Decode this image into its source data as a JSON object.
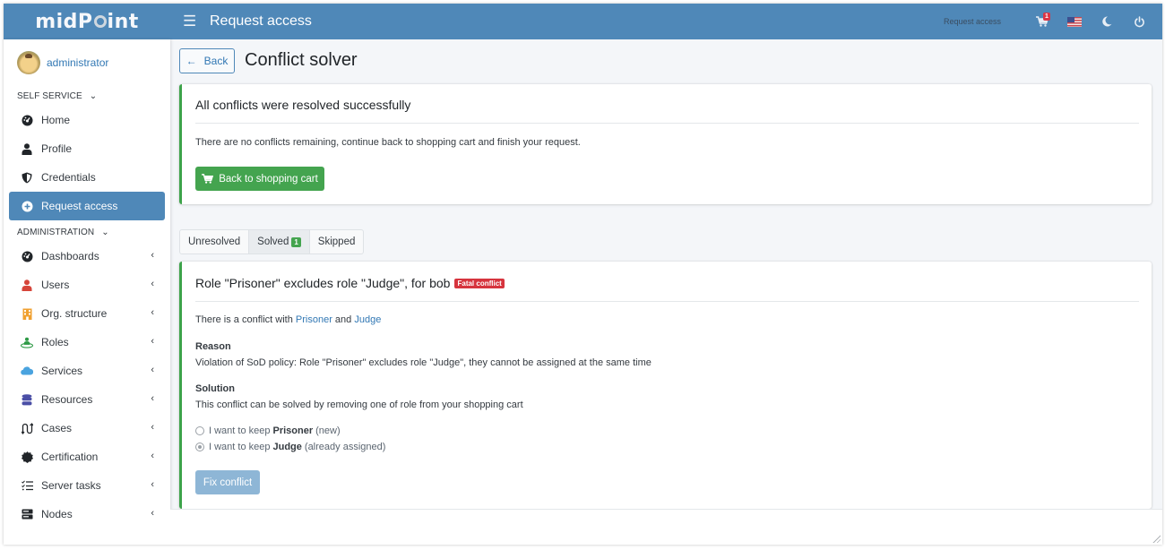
{
  "header": {
    "logo": "midPoint",
    "title": "Request access",
    "link": "Request access",
    "cart_count": "1",
    "icons": [
      "hamburger-icon",
      "cart-icon",
      "us-flag-icon",
      "moon-icon",
      "power-icon"
    ]
  },
  "user": {
    "name": "administrator"
  },
  "sidebar": {
    "self_service_title": "SELF SERVICE",
    "self_service_items": [
      {
        "label": "Home",
        "icon": "dashboard-gauge-icon"
      },
      {
        "label": "Profile",
        "icon": "user-icon"
      },
      {
        "label": "Credentials",
        "icon": "shield-icon"
      },
      {
        "label": "Request access",
        "icon": "plus-circle-icon",
        "active": true
      }
    ],
    "administration_title": "ADMINISTRATION",
    "administration_items": [
      {
        "label": "Dashboards",
        "icon": "dashboard-gauge-icon"
      },
      {
        "label": "Users",
        "icon": "user-icon"
      },
      {
        "label": "Org. structure",
        "icon": "building-icon"
      },
      {
        "label": "Roles",
        "icon": "role-icon"
      },
      {
        "label": "Services",
        "icon": "cloud-icon"
      },
      {
        "label": "Resources",
        "icon": "database-icon"
      },
      {
        "label": "Cases",
        "icon": "cases-icon"
      },
      {
        "label": "Certification",
        "icon": "certificate-icon"
      },
      {
        "label": "Server tasks",
        "icon": "tasks-list-icon"
      },
      {
        "label": "Nodes",
        "icon": "server-icon"
      }
    ]
  },
  "page": {
    "back_label": "Back",
    "title": "Conflict solver"
  },
  "success_card": {
    "title": "All conflicts were resolved successfully",
    "text": "There are no conflicts remaining, continue back to shopping cart and finish your request.",
    "button_label": "Back to shopping cart"
  },
  "tabs": [
    {
      "label": "Unresolved"
    },
    {
      "label": "Solved",
      "badge": "1",
      "active": true
    },
    {
      "label": "Skipped"
    }
  ],
  "conflict": {
    "title": "Role \"Prisoner\" excludes role \"Judge\", for bob",
    "badge": "Fatal conflict",
    "intro_prefix": "There is a conflict with",
    "role_a": "Prisoner",
    "intro_and": "and",
    "role_b": "Judge",
    "reason_label": "Reason",
    "reason_text": "Violation of SoD policy: Role \"Prisoner\" excludes role \"Judge\", they cannot be assigned at the same time",
    "solution_label": "Solution",
    "solution_text": "This conflict can be solved by removing one of role from your shopping cart",
    "options": [
      {
        "prefix": "I want to keep",
        "role": "Prisoner",
        "suffix": "(new)",
        "checked": false
      },
      {
        "prefix": "I want to keep",
        "role": "Judge",
        "suffix": "(already assigned)",
        "checked": true
      }
    ],
    "fix_button_label": "Fix conflict"
  },
  "colors": {
    "header": "#4f88b8",
    "success": "#44a44f",
    "danger": "#d6343e",
    "link": "#3278b4"
  }
}
